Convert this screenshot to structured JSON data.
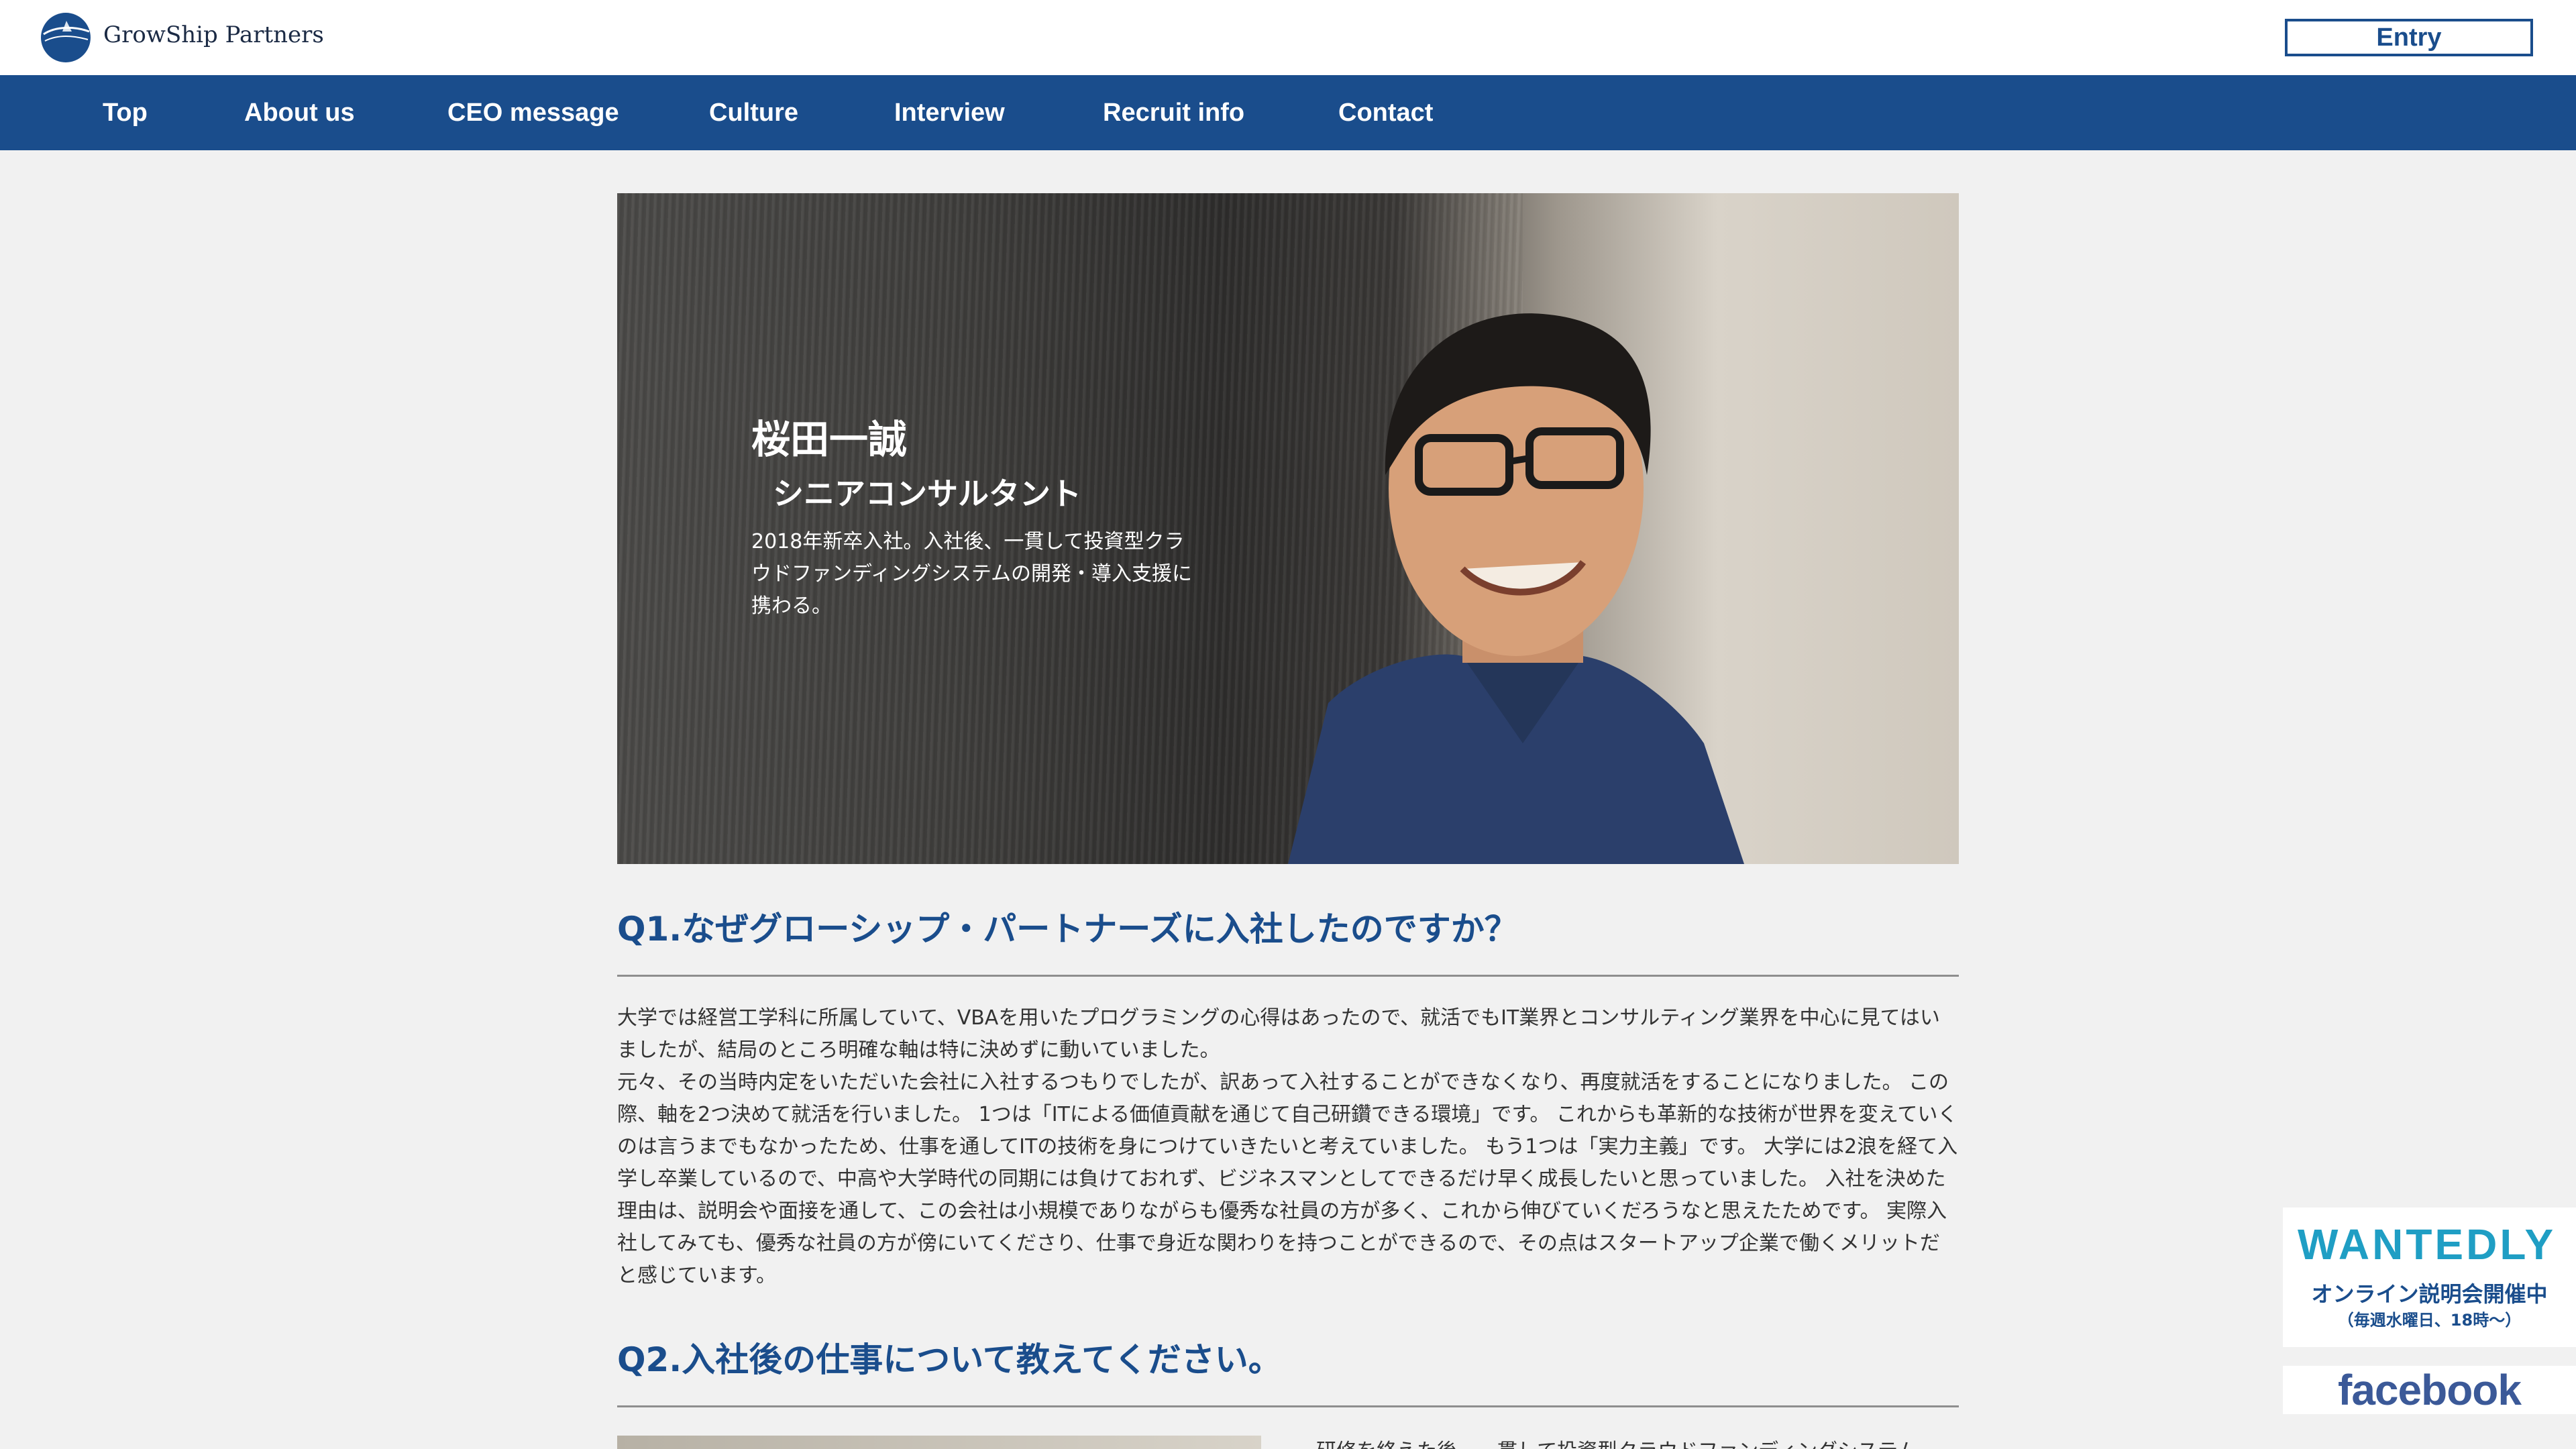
{
  "header": {
    "logo_text": "GrowShip Partners",
    "entry_label": "Entry"
  },
  "nav": {
    "items": [
      {
        "label": "Top"
      },
      {
        "label": "About us"
      },
      {
        "label": "CEO message"
      },
      {
        "label": "Culture"
      },
      {
        "label": "Interview"
      },
      {
        "label": "Recruit info"
      },
      {
        "label": "Contact"
      }
    ]
  },
  "hero": {
    "name": "桜田一誠",
    "role": "シニアコンサルタント",
    "description": "2018年新卒入社。入社後、一貫して投資型クラウドファンディングシステムの開発・導入支援に携わる。"
  },
  "q1": {
    "heading": "Q1.なぜグローシップ・パートナーズに入社したのですか？",
    "paragraphs": [
      "大学では経営工学科に所属していて、VBAを用いたプログラミングの心得はあったので、就活でもIT業界とコンサルティング業界を中心に見てはいましたが、結局のところ明確な軸は特に決めずに動いていました。",
      "元々、その当時内定をいただいた会社に入社するつもりでしたが、訳あって入社することができなくなり、再度就活をすることになりました。 この際、軸を2つ決めて就活を行いました。 1つは「ITによる価値貢献を通じて自己研鑽できる環境」です。 これからも革新的な技術が世界を変えていくのは言うまでもなかったため、仕事を通してITの技術を身につけていきたいと考えていました。 もう1つは「実力主義」です。 大学には2浪を経て入学し卒業しているので、中高や大学時代の同期には負けておれず、ビジネスマンとしてできるだけ早く成長したいと思っていました。 入社を決めた理由は、説明会や面接を通して、この会社は小規模でありながらも優秀な社員の方が多く、これから伸びていくだろうなと思えたためです。 実際入社してみても、優秀な社員の方が傍にいてくださり、仕事で身近な関わりを持つことができるので、その点はスタートアップ企業で働くメリットだと感じています。"
    ]
  },
  "q2": {
    "heading": "Q2.入社後の仕事について教えてください。",
    "text_start": "研修を終えた後、一貫して投資型クラウドファンディングシステム"
  },
  "side": {
    "wantedly_logo": "WANTEDLY",
    "wantedly_line1": "オンライン説明会開催中",
    "wantedly_line2": "（毎週水曜日、18時〜）",
    "facebook_logo": "facebook"
  },
  "colors": {
    "brand_blue": "#1a4d8c",
    "background": "#f1f1f1",
    "wantedly_cyan": "#1f9ec4",
    "facebook_blue": "#3b5998"
  }
}
